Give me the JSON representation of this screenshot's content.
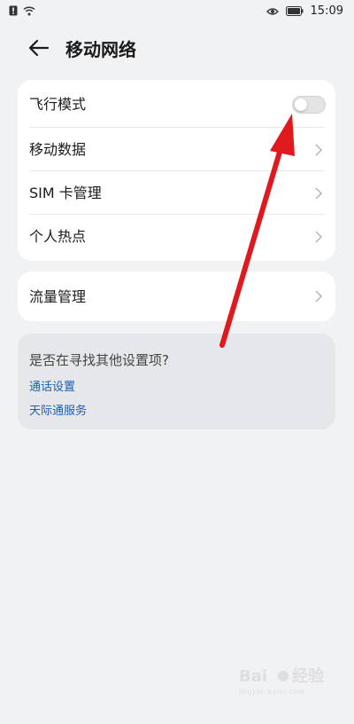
{
  "status_bar": {
    "time": "15:09",
    "icons": [
      "sim-alert-icon",
      "wifi-icon",
      "eye-icon",
      "battery-icon"
    ]
  },
  "header": {
    "title": "移动网络",
    "back_icon": "arrow-left-icon"
  },
  "main_settings": {
    "items": [
      {
        "label": "飞行模式",
        "control": "toggle",
        "toggle_on": false
      },
      {
        "label": "移动数据",
        "control": "chevron"
      },
      {
        "label": "SIM 卡管理",
        "control": "chevron"
      },
      {
        "label": "个人热点",
        "control": "chevron"
      }
    ]
  },
  "traffic_card": {
    "label": "流量管理",
    "control": "chevron"
  },
  "search_suggestions": {
    "title": "是否在寻找其他设置项?",
    "links": [
      "通话设置",
      "天际通服务"
    ]
  },
  "watermark": {
    "brand": "Bai",
    "brand_cn": "经验",
    "sub": "jingyan.baidu.com"
  },
  "colors": {
    "background": "#f1f2f4",
    "card": "#ffffff",
    "link": "#1b5eb3",
    "annotation_arrow": "#e0191e"
  }
}
